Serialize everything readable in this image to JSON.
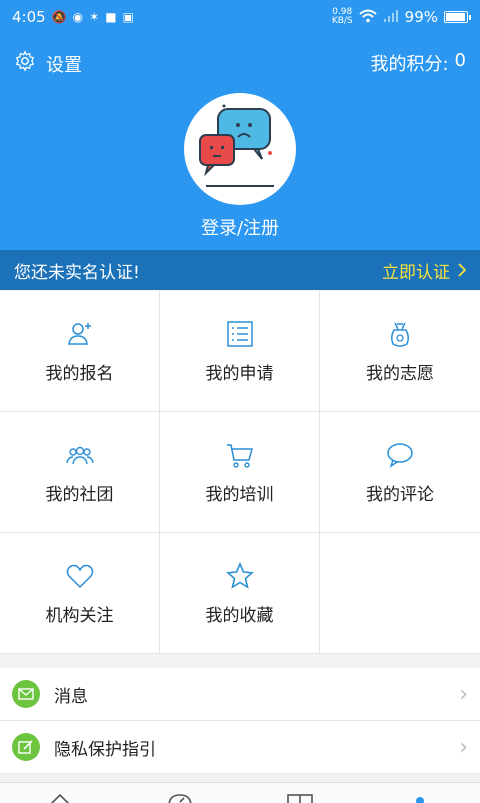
{
  "status": {
    "time": "4:05",
    "net_speed": "0.98",
    "net_unit": "KB/S",
    "battery": "99%",
    "battery_level": 0.99
  },
  "header": {
    "settings_label": "设置",
    "points_label": "我的积分:",
    "points_value": "0",
    "login_label": "登录/注册"
  },
  "verify": {
    "message": "您还未实名认证!",
    "action": "立即认证"
  },
  "grid": [
    {
      "label": "我的报名",
      "icon": "user-add-icon"
    },
    {
      "label": "我的申请",
      "icon": "list-icon"
    },
    {
      "label": "我的志愿",
      "icon": "bag-icon"
    },
    {
      "label": "我的社团",
      "icon": "group-icon"
    },
    {
      "label": "我的培训",
      "icon": "cart-icon"
    },
    {
      "label": "我的评论",
      "icon": "comment-icon"
    },
    {
      "label": "机构关注",
      "icon": "heart-icon"
    },
    {
      "label": "我的收藏",
      "icon": "star-icon"
    }
  ],
  "list": [
    {
      "label": "消息",
      "icon": "mail-icon"
    },
    {
      "label": "隐私保护指引",
      "icon": "edit-icon"
    }
  ],
  "colors": {
    "primary": "#2b97f0",
    "banner": "#1b72b8",
    "accent": "#f6e13c",
    "icon": "#2a8fd6",
    "green": "#6cc43f"
  }
}
